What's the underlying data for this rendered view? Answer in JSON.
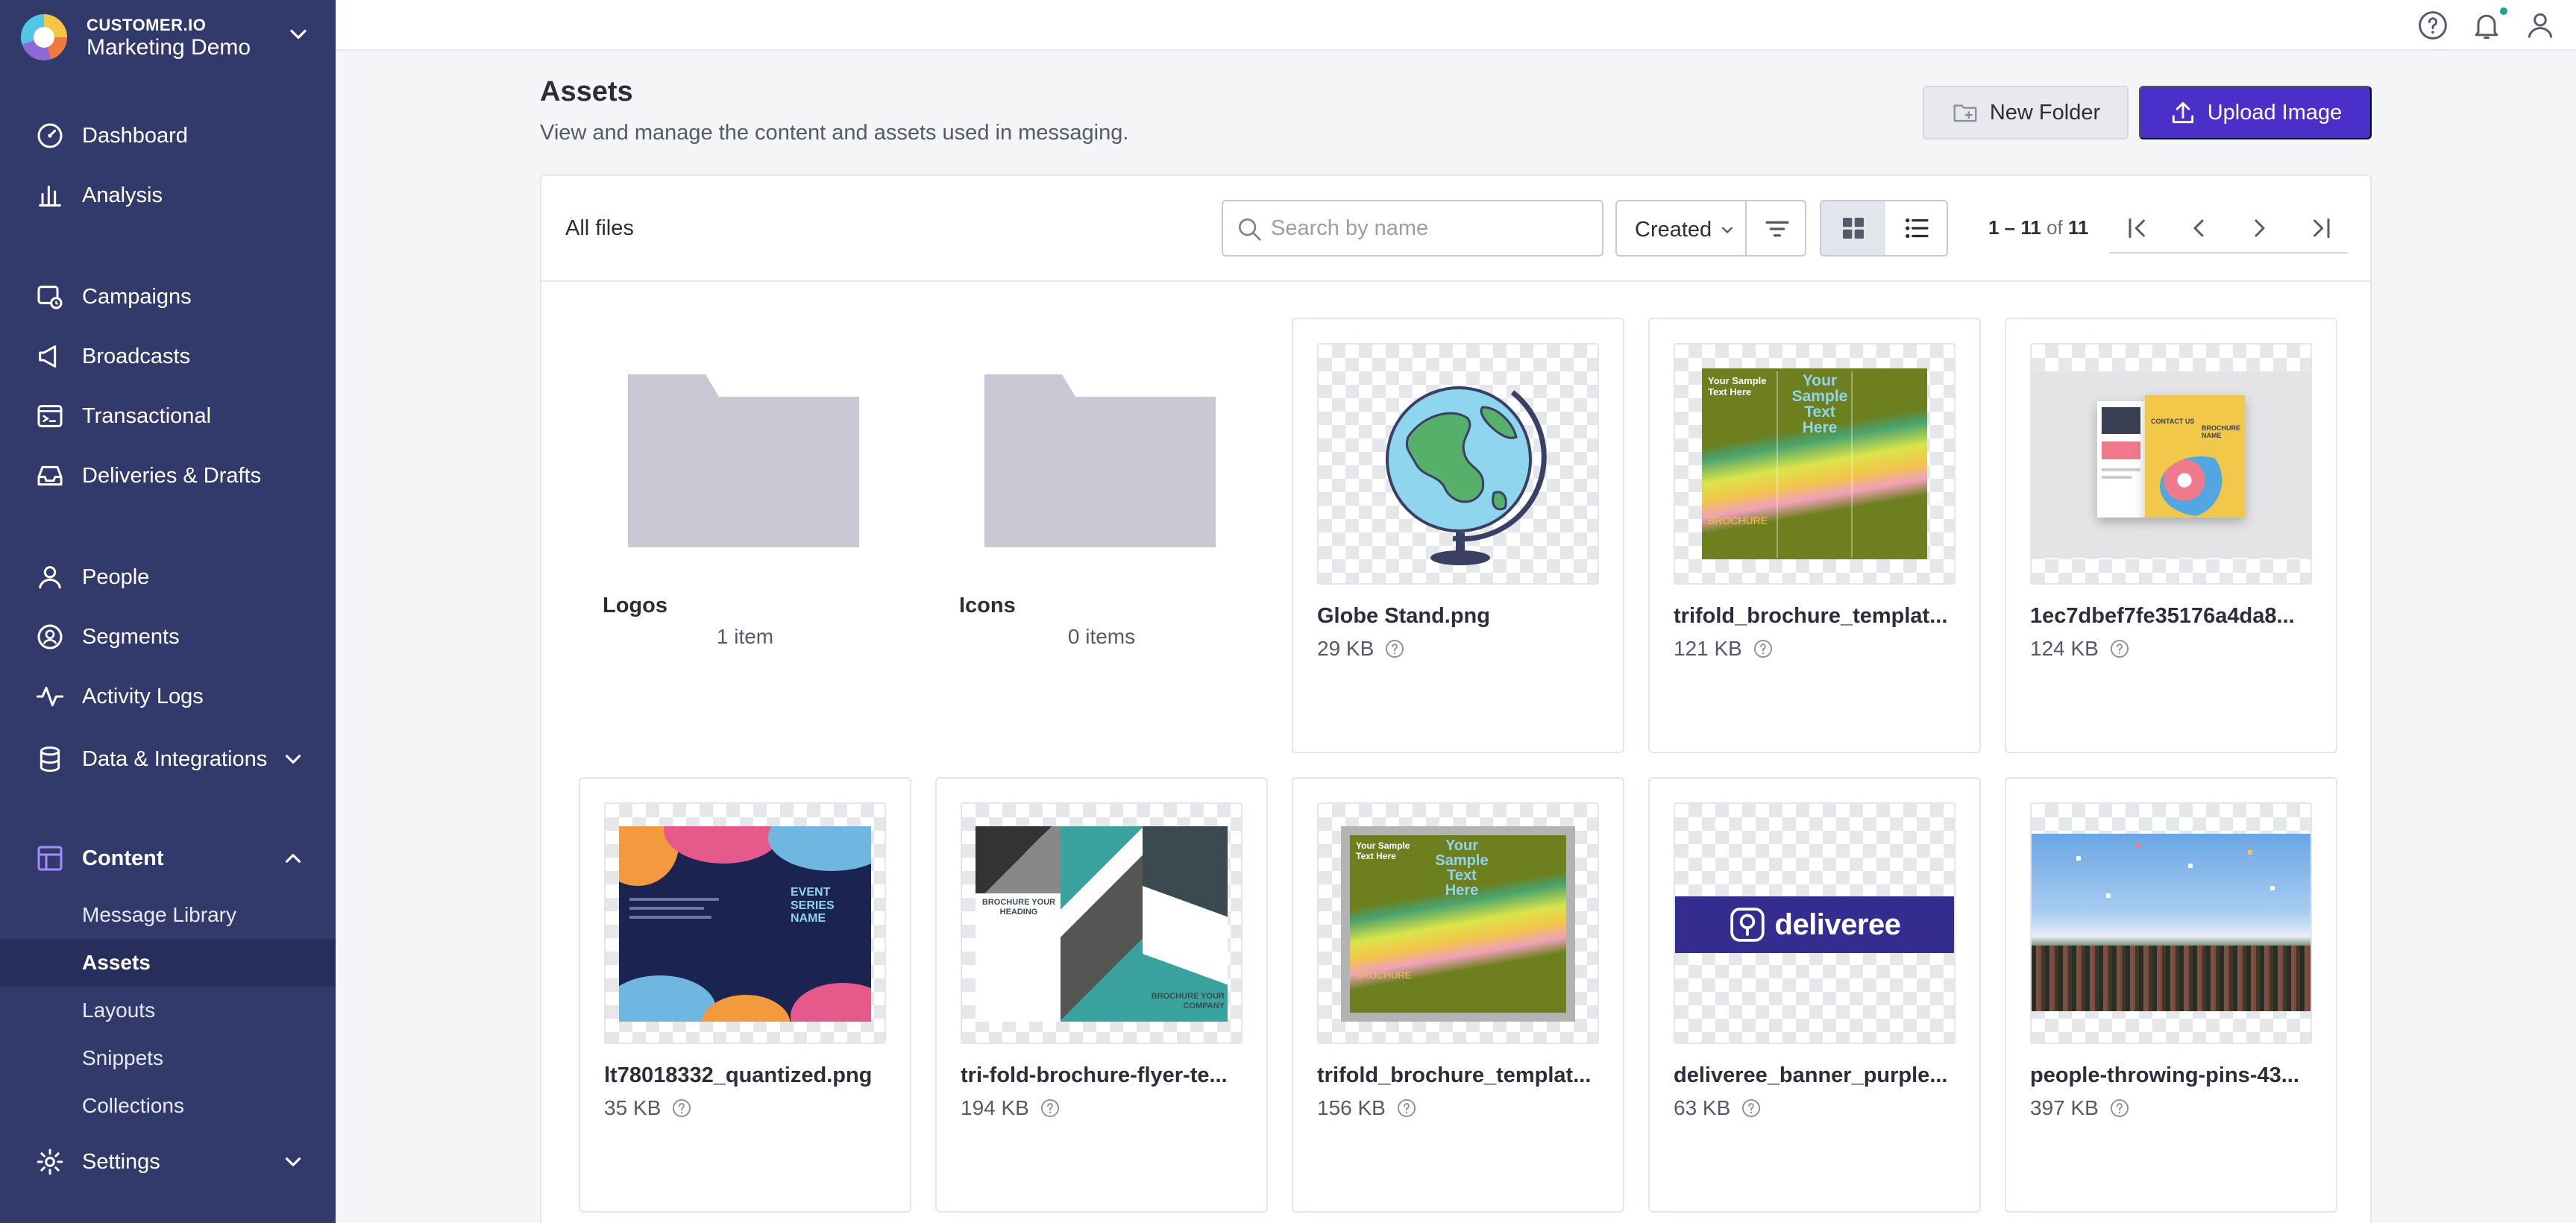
{
  "workspace": {
    "org": "CUSTOMER.IO",
    "name": "Marketing Demo"
  },
  "nav": {
    "dashboard": "Dashboard",
    "analysis": "Analysis",
    "campaigns": "Campaigns",
    "broadcasts": "Broadcasts",
    "transactional": "Transactional",
    "deliveries": "Deliveries & Drafts",
    "people": "People",
    "segments": "Segments",
    "activity_logs": "Activity Logs",
    "data_integrations": "Data & Integrations",
    "content": "Content",
    "content_sub": [
      "Message Library",
      "Assets",
      "Layouts",
      "Snippets",
      "Collections"
    ],
    "settings": "Settings"
  },
  "page": {
    "title": "Assets",
    "subtitle": "View and manage the content and assets used in messaging.",
    "new_folder": "New Folder",
    "upload_image": "Upload Image"
  },
  "toolbar": {
    "breadcrumb": "All files",
    "search_placeholder": "Search by name",
    "sort": "Created",
    "range": "1 – 11",
    "of": "of",
    "total": "11"
  },
  "folders": [
    {
      "name": "Logos",
      "count": "1 item"
    },
    {
      "name": "Icons",
      "count": "0 items"
    }
  ],
  "files": [
    {
      "name": "Globe Stand.png",
      "size": "29 KB",
      "thumb": "globe"
    },
    {
      "name": "trifold_brochure_templat...",
      "size": "121 KB",
      "thumb": "brochure-green"
    },
    {
      "name": "1ec7dbef7fe35176a4da8...",
      "size": "124 KB",
      "thumb": "brochure-mock"
    },
    {
      "name": "lt78018332_quantized.png",
      "size": "35 KB",
      "thumb": "event-flyer"
    },
    {
      "name": "tri-fold-brochure-flyer-te...",
      "size": "194 KB",
      "thumb": "brochure-teal"
    },
    {
      "name": "trifold_brochure_templat...",
      "size": "156 KB",
      "thumb": "brochure-green-gray"
    },
    {
      "name": "deliveree_banner_purple...",
      "size": "63 KB",
      "thumb": "deliveree-banner"
    },
    {
      "name": "people-throwing-pins-43...",
      "size": "397 KB",
      "thumb": "crowd-photo"
    }
  ],
  "thumb_text": {
    "brochure_green": {
      "small": "Your Sample Text Here",
      "big": "Your Sample Text Here",
      "footer": "BROCHURE"
    },
    "brochure_mock": {
      "title": "CONTACT US",
      "name": "BROCHURE NAME"
    },
    "event_flyer": {
      "title": "EVENT SERIES NAME"
    },
    "brochure_teal": {
      "left": "BROCHURE YOUR HEADING",
      "right": "BROCHURE YOUR COMPANY"
    },
    "deliveree": {
      "brand": "deliveree"
    }
  },
  "colors": {
    "sidebar": "#323a6c",
    "sidebar_active": "#272e5b",
    "primary": "#4b2fc9",
    "notification": "#16a38a"
  }
}
